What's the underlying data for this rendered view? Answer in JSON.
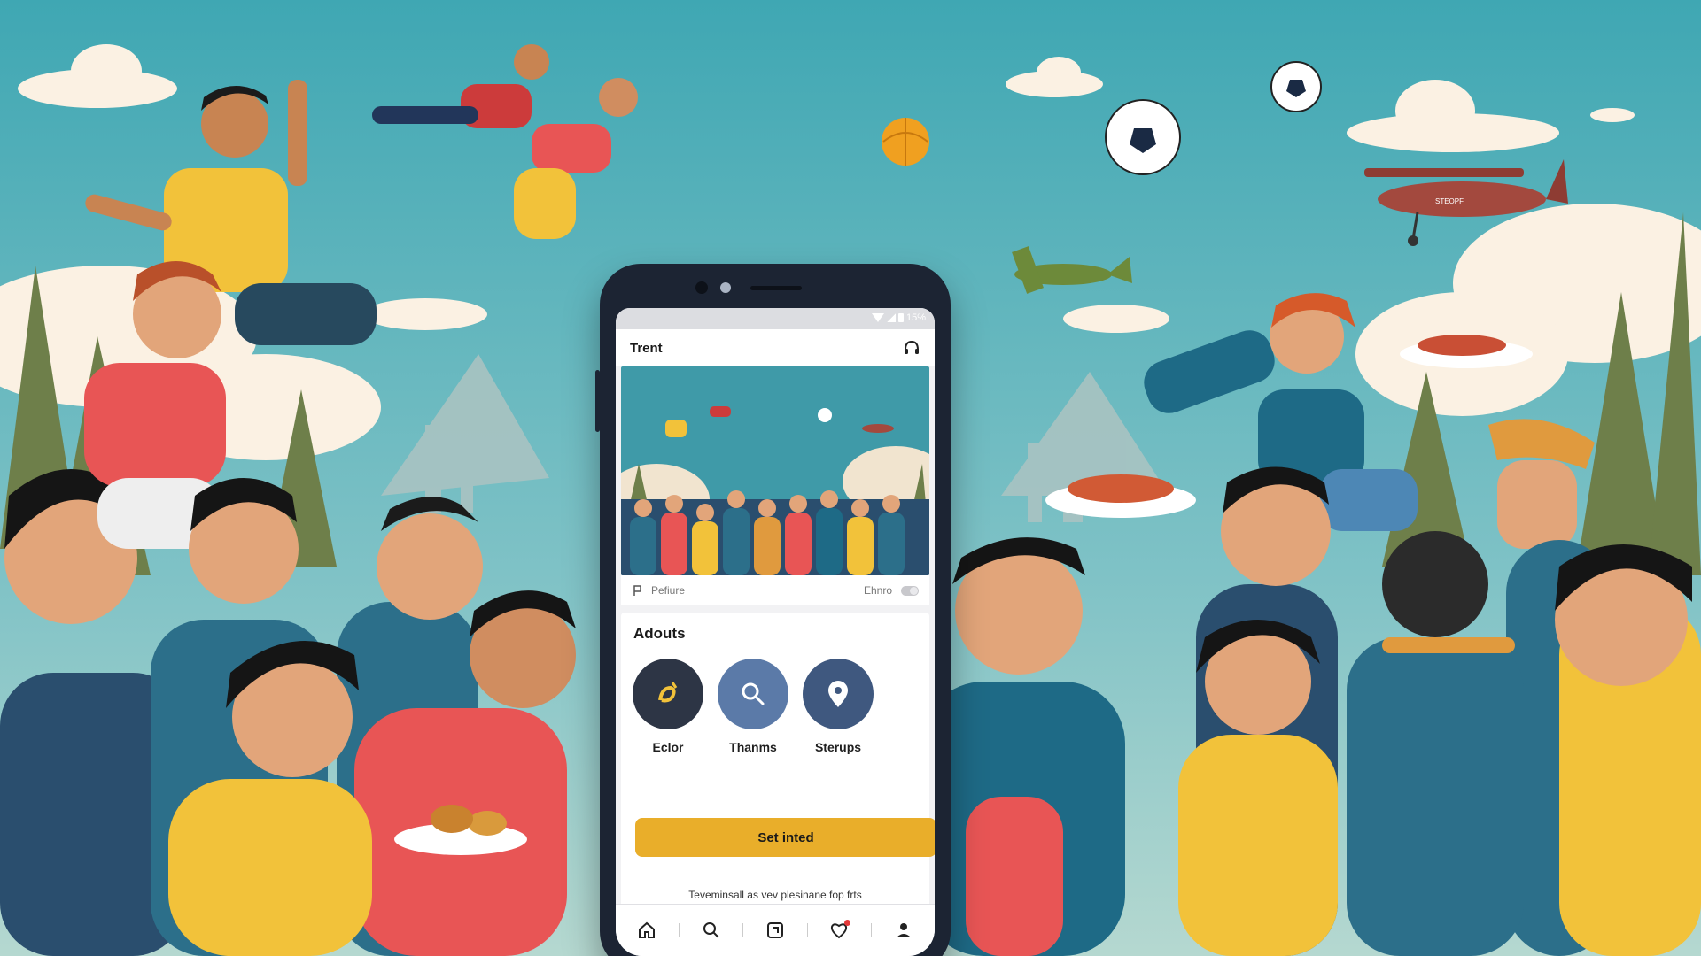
{
  "status_bar": {
    "battery_text": "15%"
  },
  "app_bar": {
    "title": "Trent",
    "action_icon": "headphones-icon"
  },
  "hero_caption": {
    "left_label": "Pefiure",
    "right_label": "Ehnro"
  },
  "section": {
    "title": "Adouts",
    "items": [
      {
        "label": "Eclor",
        "icon": "compass-pen-icon",
        "color": "#2d3545"
      },
      {
        "label": "Thanms",
        "icon": "search-icon",
        "color": "#5b7aa8"
      },
      {
        "label": "Sterups",
        "icon": "location-pin-icon",
        "color": "#3f587f"
      }
    ]
  },
  "cta": {
    "label": "Set inted",
    "color": "#e9ae2a"
  },
  "footer_note": "Teveminsall as vev plesinane fop frts",
  "bottom_nav": {
    "items": [
      {
        "icon": "home-icon"
      },
      {
        "icon": "search-icon"
      },
      {
        "icon": "add-post-icon"
      },
      {
        "icon": "heart-icon",
        "badge": true
      },
      {
        "icon": "profile-icon"
      }
    ]
  },
  "airplane_text": "STEOPF"
}
